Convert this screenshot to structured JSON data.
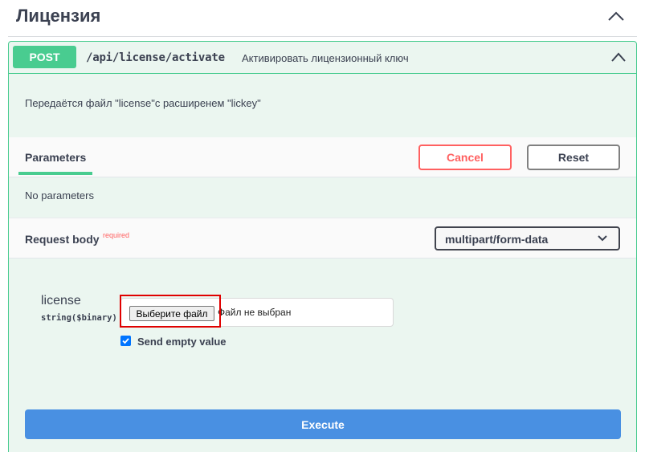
{
  "section": {
    "title": "Лицензия",
    "toggle_icon": "chevron-up-icon"
  },
  "operation": {
    "method": "POST",
    "path": "/api/license/activate",
    "summary": "Активировать лицензионный ключ",
    "toggle_icon": "chevron-up-icon",
    "description": "Передаётся файл \"license\"с расширенем \"lickey\"",
    "method_color": "#49cc90"
  },
  "parameters": {
    "tab_label": "Parameters",
    "cancel_label": "Cancel",
    "reset_label": "Reset",
    "empty_text": "No parameters"
  },
  "request_body": {
    "label": "Request body",
    "required_tag": "required",
    "content_type": "multipart/form-data",
    "field": {
      "name": "license",
      "type": "string($binary)",
      "file_button": "Выберите файл",
      "file_status": "Файл не выбран",
      "send_empty_label": "Send empty value",
      "send_empty_checked": true
    }
  },
  "execute_label": "Execute",
  "colors": {
    "accent": "#49cc90",
    "cancel": "#ff6060",
    "execute": "#4990e2",
    "highlight": "#e00000"
  }
}
